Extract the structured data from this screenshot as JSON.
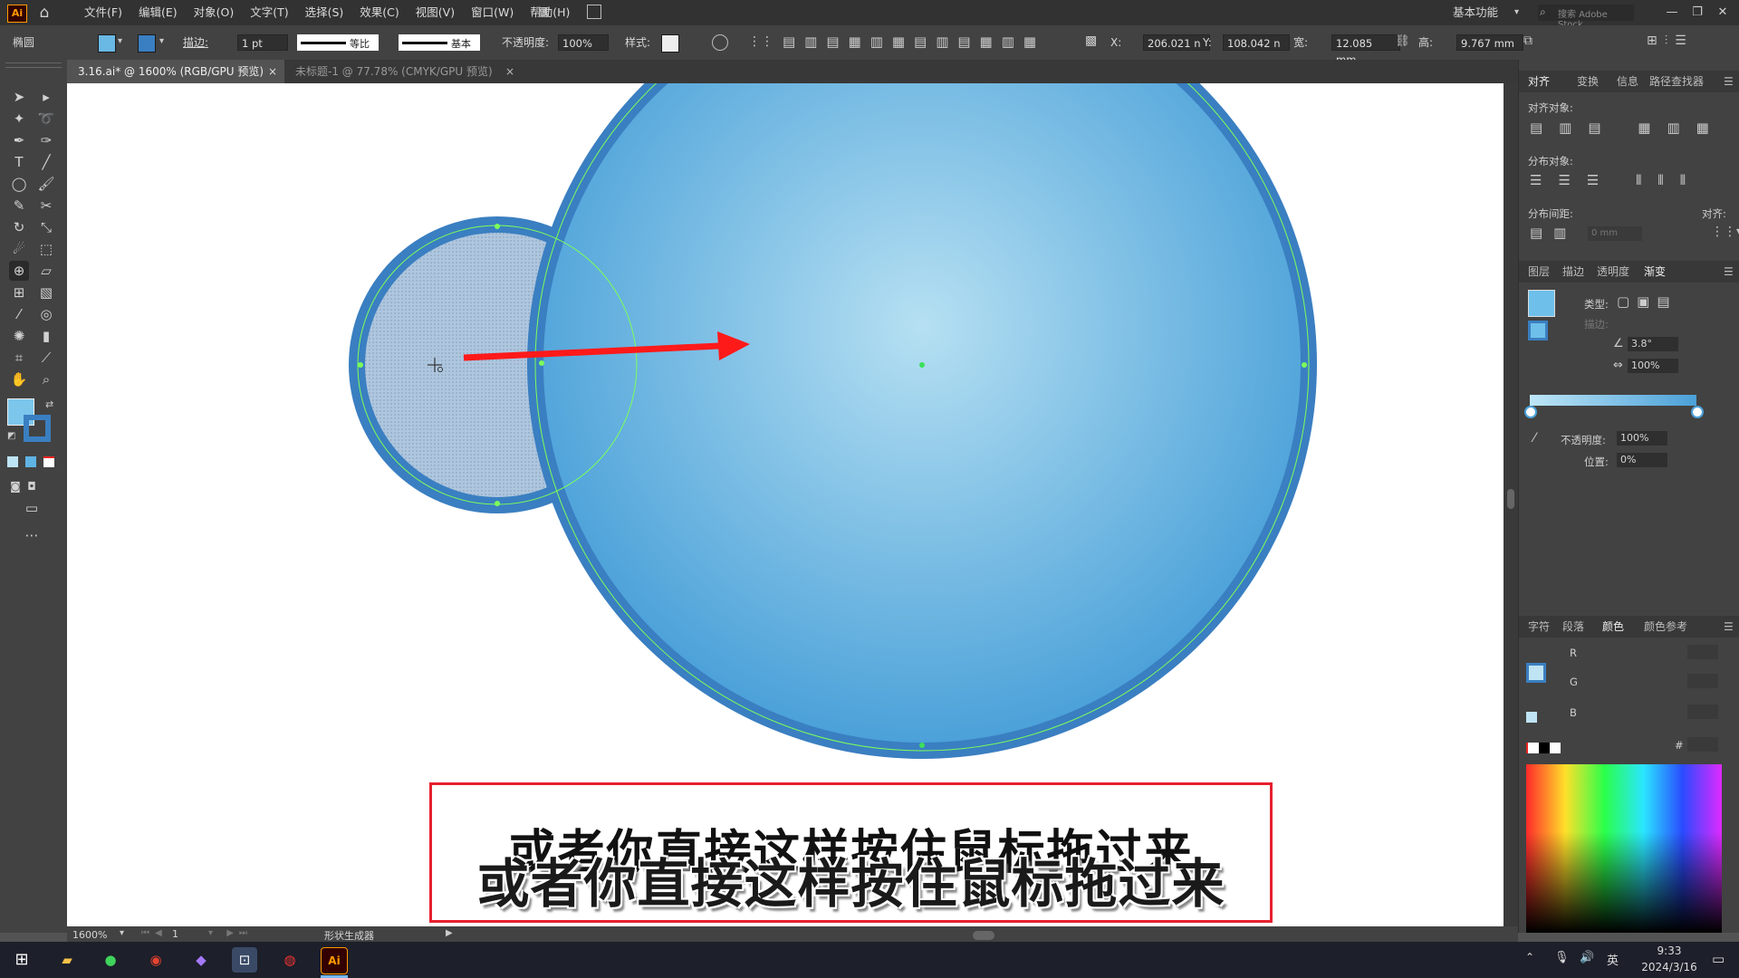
{
  "app": {
    "logo": "Ai",
    "workspace": "基本功能",
    "search_placeholder": "搜索 Adobe Stock"
  },
  "menu": [
    "文件(F)",
    "编辑(E)",
    "对象(O)",
    "文字(T)",
    "选择(S)",
    "效果(C)",
    "视图(V)",
    "窗口(W)",
    "帮助(H)"
  ],
  "control_bar": {
    "selection_label": "椭圆",
    "stroke_label": "描边:",
    "stroke_weight": "1 pt",
    "stroke_profile": "等比",
    "brush": "基本",
    "opacity_label": "不透明度:",
    "opacity": "100%",
    "style_label": "样式:",
    "x_label": "X:",
    "x": "206.021 n",
    "y_label": "Y:",
    "y": "108.042 n",
    "w_label": "宽:",
    "w": "12.085 mm",
    "h_label": "高:",
    "h": "9.767 mm"
  },
  "tabs": [
    {
      "label": "3.16.ai* @ 1600% (RGB/GPU 预览)",
      "active": true
    },
    {
      "label": "未标题-1 @ 77.78% (CMYK/GPU 预览)",
      "active": false
    }
  ],
  "tab_close": "×",
  "right_panel": {
    "top_tabs": [
      "对齐",
      "变换",
      "信息",
      "路径查找器"
    ],
    "align_objects": "对齐对象:",
    "distribute_objects": "分布对象:",
    "distribute_spacing": "分布间距:",
    "align_to": "对齐:",
    "spacing_value": "0 mm",
    "mid_tabs": [
      "图层",
      "描边",
      "透明度",
      "渐变"
    ],
    "gradient": {
      "type_label": "类型:",
      "stroke_label": "描边:",
      "angle": "3.8°",
      "aspect": "100%",
      "opacity_label": "不透明度:",
      "opacity": "100%",
      "location_label": "位置:",
      "location": "0%"
    },
    "bottom_tabs": [
      "字符",
      "段落",
      "颜色",
      "颜色参考"
    ],
    "color": {
      "r": "R",
      "g": "G",
      "b": "B",
      "hex": "#"
    }
  },
  "status": {
    "zoom": "1600%",
    "artboard": "1",
    "tool": "形状生成器"
  },
  "subtitle": {
    "top": "或者你直接这样按住鼠标拖过来",
    "main": "或者你直接这样按住鼠标拖过来"
  },
  "taskbar": {
    "time": "9:33",
    "date": "2024/3/16",
    "ime": "英"
  },
  "colors": {
    "accent_blue": "#3a7fc1",
    "gradient_light": "#a8daf0",
    "gradient_dark": "#4aa0d8",
    "arrow": "#ff1a1a",
    "guide_green": "#7cff5a"
  }
}
